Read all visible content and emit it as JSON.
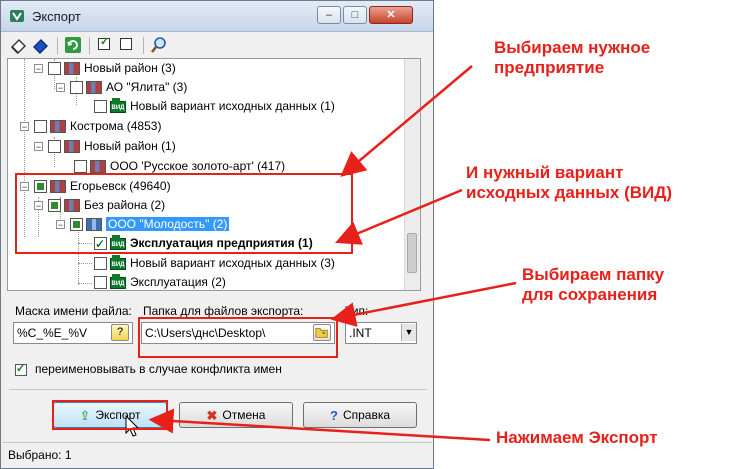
{
  "window": {
    "title": "Экспорт",
    "controls": {
      "minimize": "–",
      "maximize": "□",
      "close": "✕"
    }
  },
  "toolbar": {
    "icons": [
      "eraser-icon",
      "eraser-blue-icon",
      "refresh-icon",
      "check-all-icon",
      "uncheck-all-icon",
      "search-icon"
    ]
  },
  "tree": {
    "rows": [
      {
        "label": "Новый район (3)"
      },
      {
        "label": "АО \"Ялита\" (3)"
      },
      {
        "label": "Новый вариант исходных данных (1)"
      },
      {
        "label": "Кострома (4853)"
      },
      {
        "label": "Новый район (1)"
      },
      {
        "label": "ООО 'Русское золото-арт' (417)"
      },
      {
        "label": "Егорьевск (49640)"
      },
      {
        "label": "Без района (2)"
      },
      {
        "label": "ООО \"Молодость\" (2)"
      },
      {
        "label": "Эксплуатация предприятия (1)"
      },
      {
        "label": "Новый вариант исходных данных (3)"
      },
      {
        "label": "Эксплуатация (2)"
      }
    ]
  },
  "form": {
    "mask_label": "Маска имени файла:",
    "mask_value": "%C_%E_%V",
    "mask_help": "?",
    "folder_label": "Папка для файлов экспорта:",
    "folder_value": "C:\\Users\\днс\\Desktop\\",
    "type_label": "Тип:",
    "type_value": ".INT",
    "rename_label": "переименовывать в случае конфликта имен",
    "rename_checked": true
  },
  "buttons": {
    "export": "Экспорт",
    "cancel": "Отмена",
    "help": "Справка"
  },
  "status": {
    "selected": "Выбрано: 1"
  },
  "annotations": {
    "choose_enterprise": "Выбираем нужное\nпредприятие",
    "choose_variant": "И нужный вариант\nисходных данных (ВИД)",
    "choose_folder": "Выбираем папку\nдля сохранения",
    "press_export": "Нажимаем Экспорт",
    "color": "#e8201a"
  }
}
